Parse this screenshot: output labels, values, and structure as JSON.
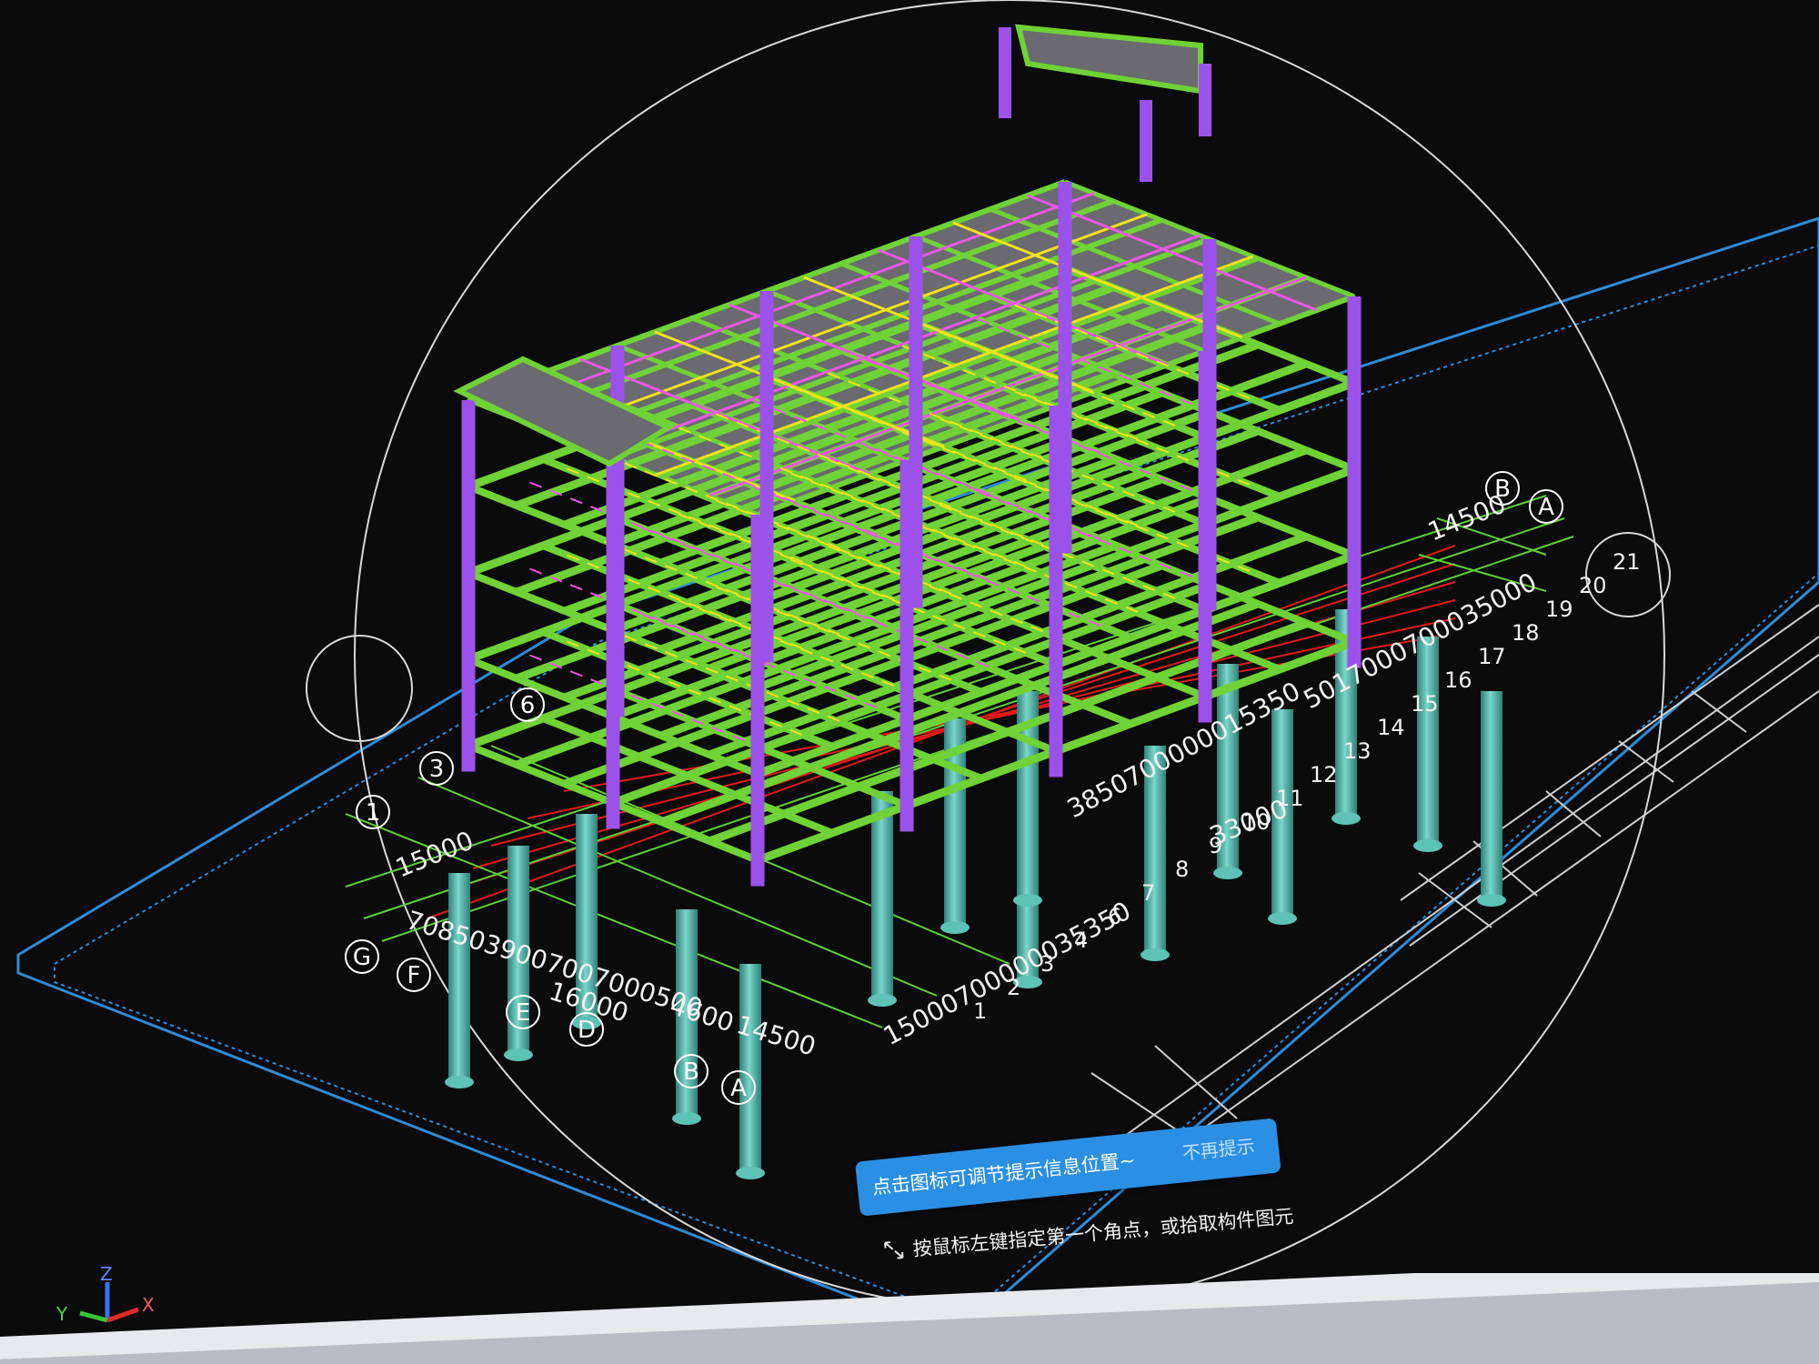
{
  "app": {
    "tip": {
      "message": "点击图标可调节提示信息位置~",
      "dismiss": "不再提示"
    },
    "command_prompt": "按鼠标左键指定第一个角点，或拾取构件图元"
  },
  "axis_labels_front": [
    "G",
    "F",
    "E",
    "D",
    "B",
    "A"
  ],
  "axis_labels_left": [
    "1",
    "3",
    "6"
  ],
  "axis_labels_right": [
    "B",
    "A"
  ],
  "axis_labels_right_numbers": [
    "1",
    "2",
    "3",
    "4",
    "6",
    "7",
    "8",
    "9",
    "10",
    "11",
    "12",
    "13",
    "14",
    "15",
    "16",
    "17",
    "18",
    "19",
    "20",
    "21"
  ],
  "dimension_texts": {
    "front_left": "15000",
    "front_long": "7085039007007000500",
    "front_16000": "16000",
    "front_4600": "4600",
    "front_14500": "14500",
    "front_right_long": "15000700000035350",
    "mid_long": "3850700000015350",
    "right_33000": "33000",
    "right_14500": "14500",
    "right_top": "5017000700035000"
  },
  "ucs_icon": {
    "x": "X",
    "y": "Y",
    "z": "Z"
  },
  "colors": {
    "beam": "#6fd236",
    "column": "#9c52ea",
    "slab": "#6a6a70",
    "rebar_yellow": "#f2e21a",
    "rebar_magenta": "#ee56e6",
    "pile": "#4fb4a8",
    "grid_green": "#5fcf3a",
    "grid_red": "#e01a1a",
    "frame_blue": "#2f8bd6",
    "tip_bg": "#2b8fe3"
  }
}
